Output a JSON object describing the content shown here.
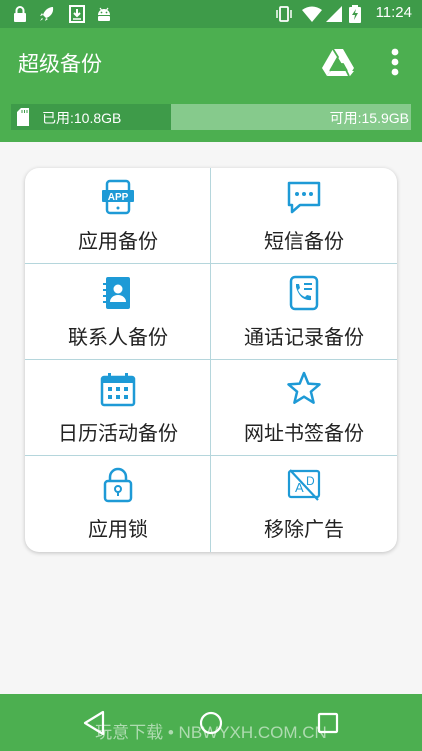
{
  "status_bar": {
    "time": "11:24",
    "icons": [
      "lock-icon",
      "rocket-icon",
      "download-icon",
      "android-icon",
      "vibrate-icon",
      "wifi-icon",
      "cellular-icon",
      "battery-charging-icon"
    ]
  },
  "app_bar": {
    "title": "超级备份",
    "actions": [
      "google-drive-icon",
      "more-vert-icon"
    ]
  },
  "storage": {
    "used_label": "已用:10.8GB",
    "available_label": "可用:15.9GB",
    "used_fraction": 0.4
  },
  "grid": {
    "items": [
      {
        "label": "应用备份",
        "icon": "app-icon"
      },
      {
        "label": "短信备份",
        "icon": "sms-icon"
      },
      {
        "label": "联系人备份",
        "icon": "contacts-icon"
      },
      {
        "label": "通话记录备份",
        "icon": "call-log-icon"
      },
      {
        "label": "日历活动备份",
        "icon": "calendar-icon"
      },
      {
        "label": "网址书签备份",
        "icon": "bookmark-star-icon"
      },
      {
        "label": "应用锁",
        "icon": "lock-icon"
      },
      {
        "label": "移除广告",
        "icon": "remove-ads-icon"
      }
    ]
  },
  "nav_bar": {
    "buttons": [
      "back-icon",
      "home-icon",
      "recents-icon"
    ],
    "watermark": "玩意下载 • NBWYXH.COM.CN"
  },
  "colors": {
    "status_bar": "#3e9b49",
    "app_bar": "#4caf50",
    "storage_used": "#3e9b49",
    "storage_free": "#86ca8c",
    "icon_blue": "#1e9ad6",
    "grid_line": "#b5d6dc"
  }
}
